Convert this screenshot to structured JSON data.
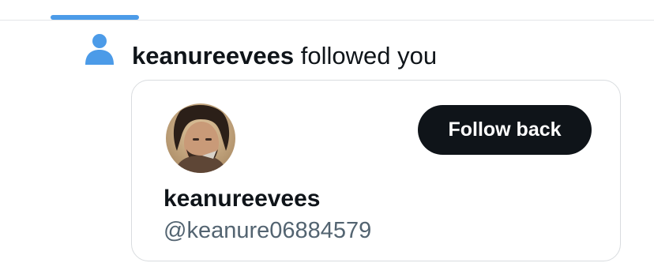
{
  "notification": {
    "icon": "person-icon",
    "username": "keanureevees",
    "action_text": " followed you"
  },
  "profile_card": {
    "display_name": "keanureevees",
    "handle": "@keanure06884579",
    "follow_back_label": "Follow back"
  },
  "colors": {
    "accent": "#4c9be8",
    "button_bg": "#0f1419",
    "text_primary": "#0f1419",
    "text_secondary": "#536471",
    "border": "#d9dcdf"
  }
}
